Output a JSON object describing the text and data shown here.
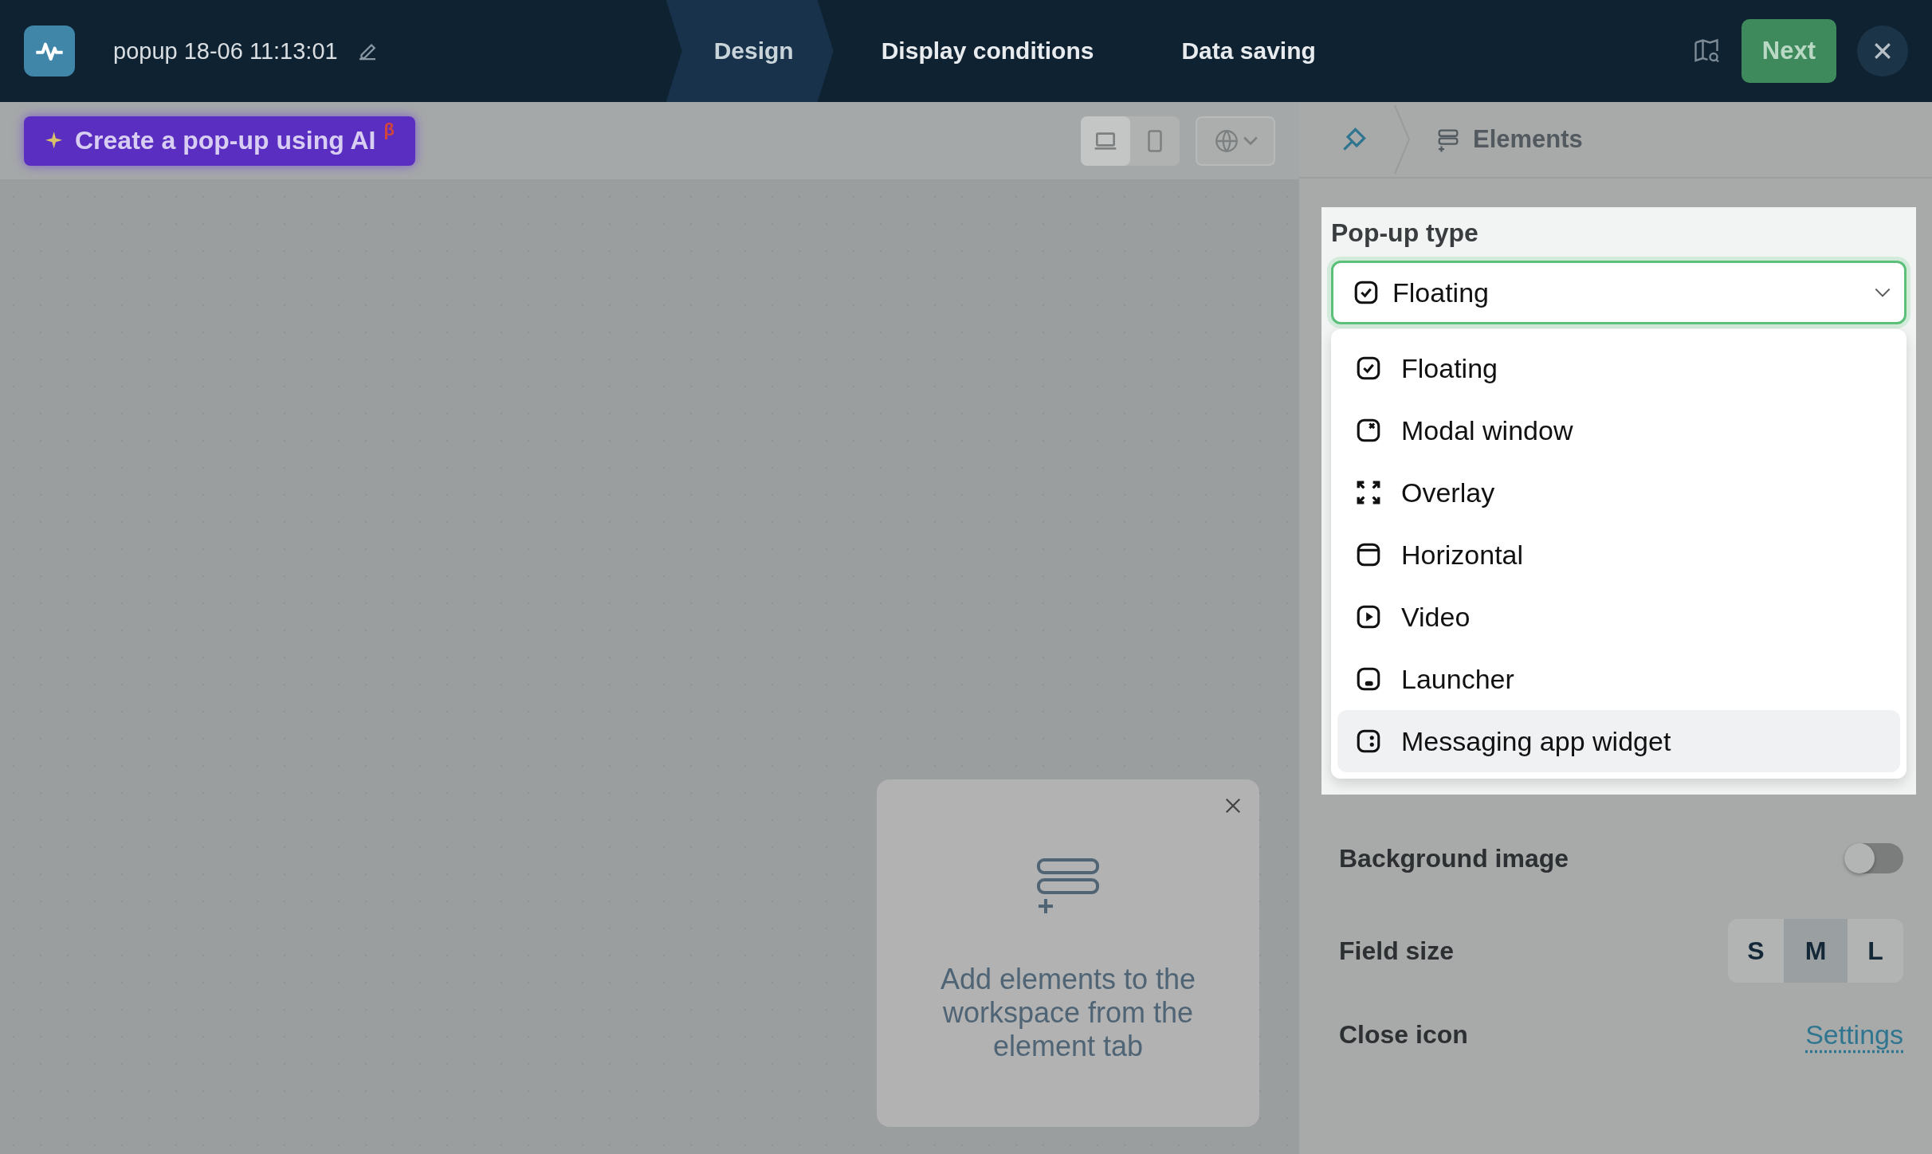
{
  "header": {
    "title": "popup 18-06 11:13:01",
    "steps": [
      {
        "label": "Design",
        "selected": true
      },
      {
        "label": "Display conditions",
        "selected": false
      },
      {
        "label": "Data saving",
        "selected": false
      }
    ],
    "next_button": "Next"
  },
  "toolbar": {
    "ai_button": "Create a pop-up using AI",
    "ai_badge": "β",
    "devices": [
      {
        "kind": "desktop",
        "selected": true
      },
      {
        "kind": "mobile",
        "selected": false
      }
    ]
  },
  "hint_card": {
    "text": "Add elements to the workspace from the element tab"
  },
  "panel": {
    "breadcrumb": "Elements",
    "popup_type": {
      "label": "Pop-up type",
      "value": "Floating",
      "options": [
        {
          "label": "Floating",
          "kind": "floating",
          "hovered": false,
          "selected": true
        },
        {
          "label": "Modal window",
          "kind": "modal",
          "hovered": false,
          "selected": false
        },
        {
          "label": "Overlay",
          "kind": "overlay",
          "hovered": false,
          "selected": false
        },
        {
          "label": "Horizontal",
          "kind": "horizontal",
          "hovered": false,
          "selected": false
        },
        {
          "label": "Video",
          "kind": "video",
          "hovered": false,
          "selected": false
        },
        {
          "label": "Launcher",
          "kind": "launcher",
          "hovered": false,
          "selected": false
        },
        {
          "label": "Messaging app widget",
          "kind": "messaging",
          "hovered": true,
          "selected": false
        }
      ]
    },
    "background_image": {
      "label": "Background image",
      "on": false
    },
    "field_size": {
      "label": "Field size",
      "options": [
        {
          "label": "S",
          "selected": false
        },
        {
          "label": "M",
          "selected": true
        },
        {
          "label": "L",
          "selected": false
        }
      ]
    },
    "close_icon": {
      "label": "Close icon",
      "link": "Settings"
    }
  }
}
